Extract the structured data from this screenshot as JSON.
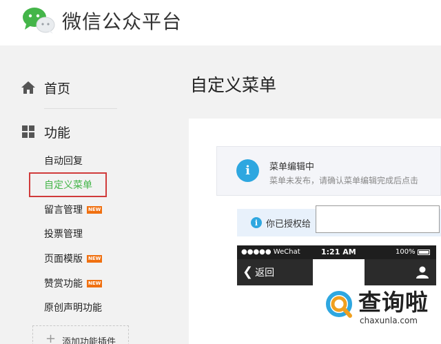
{
  "header": {
    "title": "微信公众平台",
    "logo_icon": "wechat-logo-icon"
  },
  "sidebar": {
    "home": {
      "label": "首页",
      "icon": "home-icon"
    },
    "functions": {
      "label": "功能",
      "icon": "grid-icon"
    },
    "items": [
      {
        "label": "自动回复",
        "new": false
      },
      {
        "label": "自定义菜单",
        "new": false,
        "active": true
      },
      {
        "label": "留言管理",
        "new": true
      },
      {
        "label": "投票管理",
        "new": false
      },
      {
        "label": "页面模版",
        "new": true
      },
      {
        "label": "赞赏功能",
        "new": true
      },
      {
        "label": "原创声明功能",
        "new": false
      }
    ],
    "new_badge": "NEW",
    "add_plugin": {
      "label": "添加功能插件",
      "plus": "+"
    }
  },
  "main": {
    "page_title": "自定义菜单",
    "notice": {
      "icon_glyph": "i",
      "title": "菜单编辑中",
      "desc": "菜单未发布，请确认菜单编辑完成后点击"
    },
    "auth_bar": {
      "icon_glyph": "i",
      "text": "你已授权给"
    },
    "phone": {
      "status_left": "●●●●● WeChat",
      "time": "1:21 AM",
      "battery": "100%",
      "back_chevron": "❮",
      "back_label": "返回",
      "user_icon": "person-icon"
    }
  },
  "watermark": {
    "text": "查询啦",
    "url": "chaxunla.com"
  },
  "colors": {
    "accent_green": "#44b549",
    "highlight_red": "#d03a3a",
    "info_blue": "#2ea7e0",
    "new_badge": "#f07010"
  }
}
